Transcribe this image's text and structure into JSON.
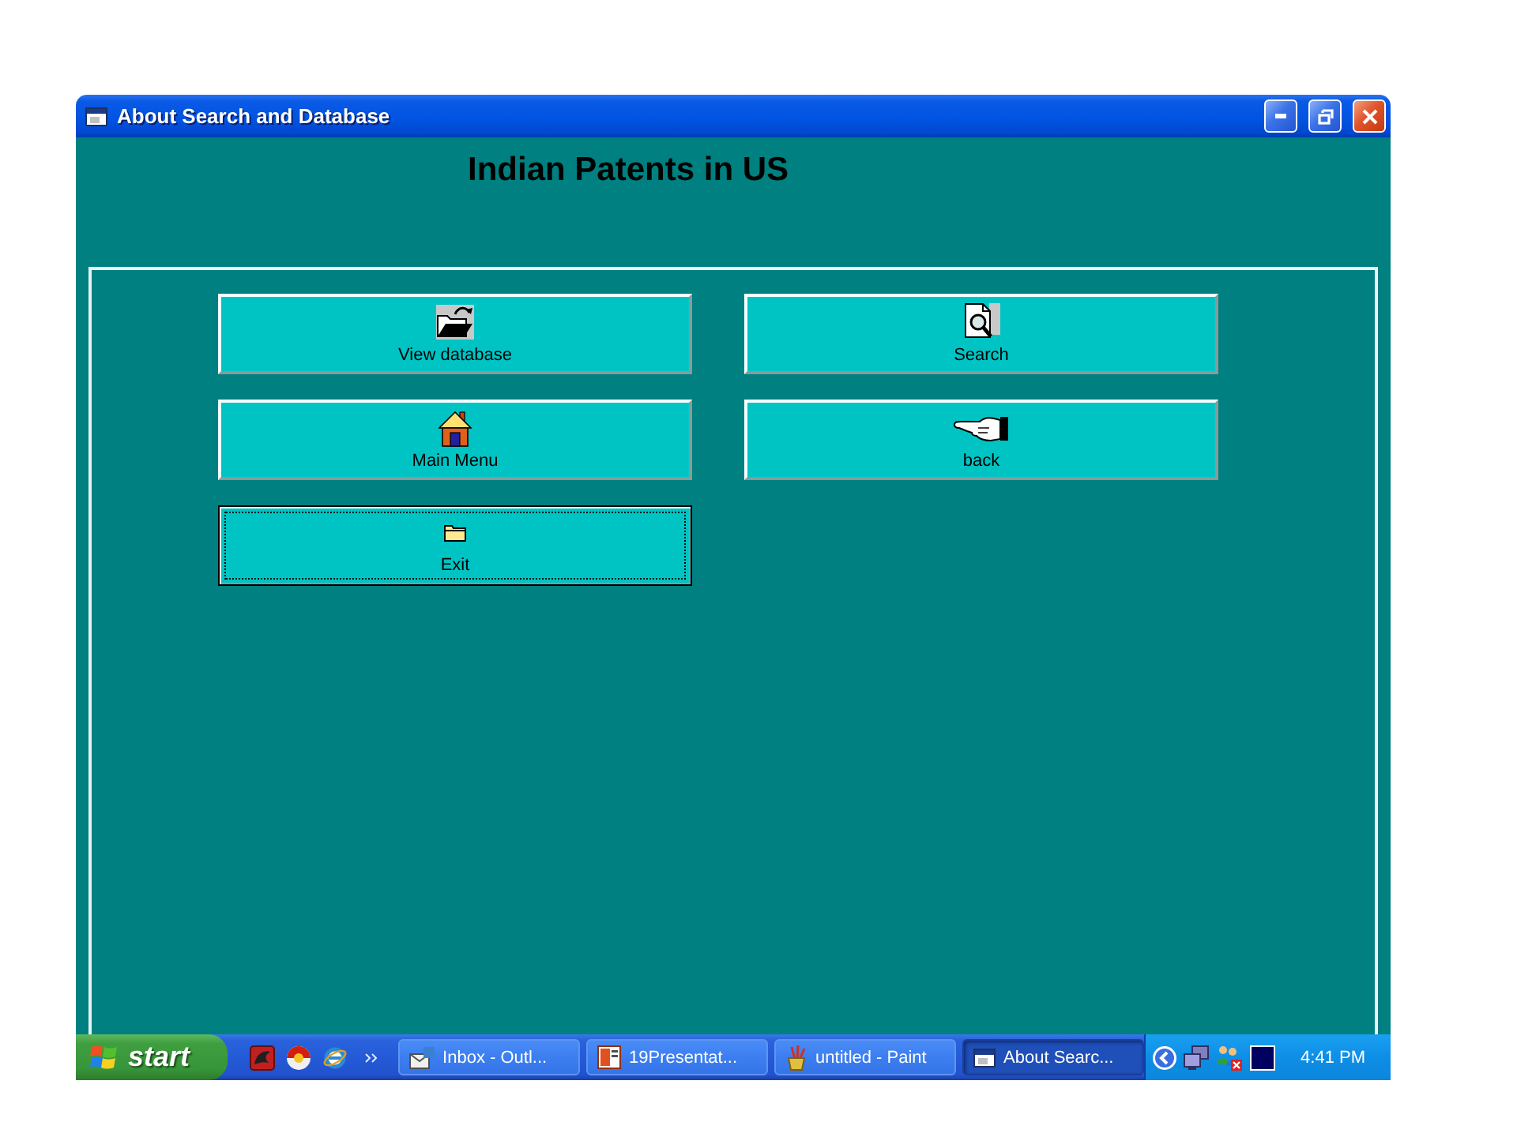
{
  "window": {
    "title": "About Search and Database"
  },
  "heading": "Indian Patents in US",
  "buttons": [
    {
      "label": "View database",
      "focused": false
    },
    {
      "label": "Search",
      "focused": false
    },
    {
      "label": "Main Menu",
      "focused": false
    },
    {
      "label": "back",
      "focused": false
    },
    {
      "label": "Exit",
      "focused": true
    }
  ],
  "taskbar": {
    "start": "start",
    "tasks": [
      {
        "label": "Inbox - Outl...",
        "selected": false
      },
      {
        "label": "19Presentat...",
        "selected": false
      },
      {
        "label": "untitled - Paint",
        "selected": false
      },
      {
        "label": "About Searc...",
        "selected": true
      }
    ],
    "clock": "4:41 PM"
  }
}
